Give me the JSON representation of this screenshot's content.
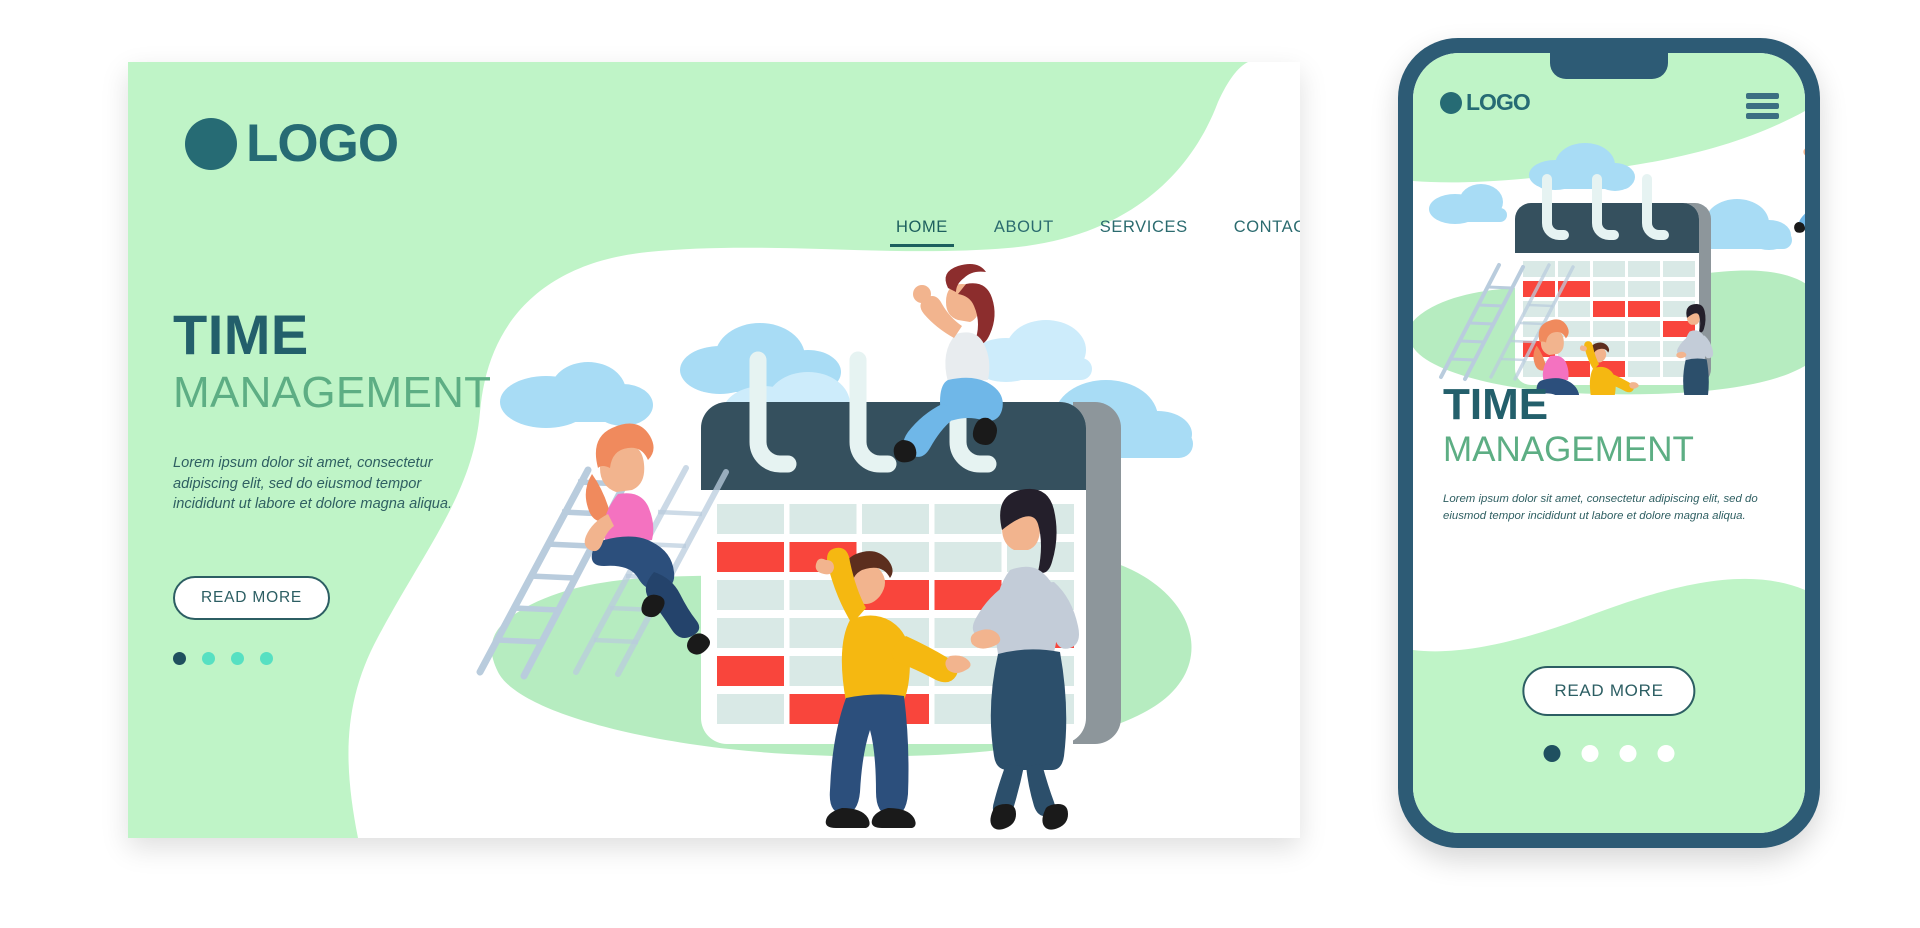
{
  "brand": {
    "logo_text": "LOGO",
    "logo_icon": "circle-dot-icon"
  },
  "colors": {
    "mint": "#bff4c7",
    "teal_dark": "#235f6b",
    "green_accent": "#5dae84",
    "dot_active": "#1f4f5e",
    "dot_inactive": "#57e0c2",
    "calendar_header": "#35505e",
    "cell": "#d9e9e6",
    "cell_highlight": "#f9453c",
    "cloud": "#a8dcf5",
    "phone_frame": "#2d5b75"
  },
  "desktop": {
    "nav": [
      {
        "label": "HOME",
        "active": true
      },
      {
        "label": "ABOUT",
        "active": false
      },
      {
        "label": "SERVICES",
        "active": false
      },
      {
        "label": "CONTACT",
        "active": false
      }
    ],
    "menu_icon": "hamburger-menu-icon",
    "hero": {
      "title_line1": "TIME",
      "title_line2": "MANAGEMENT",
      "paragraph": "Lorem ipsum dolor sit amet, consectetur adipiscing elit, sed do eiusmod tempor incididunt ut labore et dolore magna aliqua.",
      "cta_label": "READ MORE",
      "carousel_dots": 4,
      "carousel_active_index": 0
    }
  },
  "phone": {
    "menu_icon": "hamburger-menu-icon",
    "hero": {
      "title_line1": "TIME",
      "title_line2": "MANAGEMENT",
      "paragraph": "Lorem ipsum dolor sit amet, consectetur adipiscing elit, sed do eiusmod tempor incididunt ut labore et dolore magna aliqua.",
      "cta_label": "READ MORE",
      "carousel_dots": 4,
      "carousel_active_index": 0
    }
  },
  "illustration": {
    "name": "time-management-calendar-illustration",
    "calendar": {
      "rings": 3,
      "columns": 5,
      "rows": 6,
      "highlighted_cells": [
        {
          "row": 2,
          "cols": [
            1,
            2
          ]
        },
        {
          "row": 3,
          "cols": [
            3,
            4
          ]
        },
        {
          "row": 4,
          "cols": [
            5
          ]
        },
        {
          "row": 5,
          "cols": [
            1
          ]
        },
        {
          "row": 6,
          "cols": [
            2,
            3
          ]
        }
      ]
    },
    "characters": [
      {
        "name": "woman-on-ladder",
        "hair": "#f08a5d",
        "top": "#f472c0",
        "bottom": "#2c4f7c"
      },
      {
        "name": "woman-sitting-on-calendar",
        "hair": "#8c2d2d",
        "top": "#e8ecef",
        "bottom": "#6fb7e8"
      },
      {
        "name": "man-pointing",
        "hair": "#5c2e1e",
        "top": "#f5b811",
        "bottom": "#2c4f7c"
      },
      {
        "name": "woman-standing",
        "hair": "#241f2b",
        "top": "#c3ccd8",
        "bottom": "#2c4f6b"
      }
    ],
    "clouds": 4,
    "ladder": "step-ladder"
  }
}
